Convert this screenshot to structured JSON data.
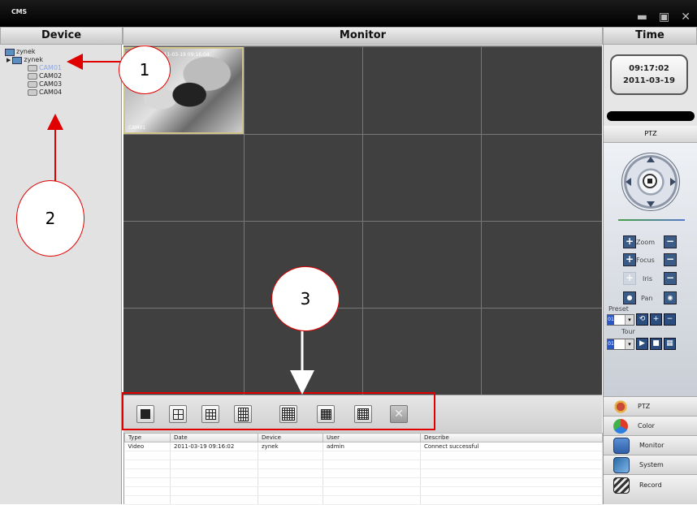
{
  "window": {
    "title": "CMS",
    "controls": [
      "minimize",
      "maximize",
      "close"
    ]
  },
  "headers": {
    "device": "Device",
    "monitor": "Monitor",
    "time": "Time"
  },
  "tree": {
    "root": "zynek",
    "device": "zynek",
    "cameras": [
      "CAM01",
      "CAM02",
      "CAM03",
      "CAM04"
    ],
    "selected_camera": "CAM01"
  },
  "clock": {
    "time": "09:17:02",
    "date": "2011-03-19"
  },
  "ptz": {
    "header": "PTZ",
    "zoom": "Zoom",
    "focus": "Focus",
    "iris": "Iris",
    "pan": "Pan",
    "preset": "Preset",
    "tour": "Tour",
    "preset_value": "01",
    "tour_value": "01"
  },
  "menu": [
    {
      "label": "PTZ",
      "icon": "ptz-menu-icon"
    },
    {
      "label": "Color",
      "icon": "color-menu-icon"
    },
    {
      "label": "Monitor",
      "icon": "monitor-menu-icon"
    },
    {
      "label": "System",
      "icon": "system-menu-icon"
    },
    {
      "label": "Record",
      "icon": "record-menu-icon"
    }
  ],
  "monitor": {
    "grid": "4x4",
    "active_channel_label": "CAM01",
    "active_channel_timestamp": "2011-03-19 09:16:04"
  },
  "layouts": [
    "1-split",
    "4-split",
    "9-split",
    "16-split",
    "25-split",
    "36-split",
    "64-split",
    "fullscreen"
  ],
  "log": {
    "columns": [
      "Type",
      "Date",
      "Device",
      "User",
      "Describe"
    ],
    "rows": [
      [
        "Video",
        "2011-03-19 09:16:02",
        "zynek",
        "admin",
        "Connect successful"
      ]
    ]
  },
  "annotations": [
    "1",
    "2",
    "3"
  ],
  "colors": {
    "annotation_red": "#e00000",
    "cell": "#404040",
    "titlebar": "#000000"
  }
}
